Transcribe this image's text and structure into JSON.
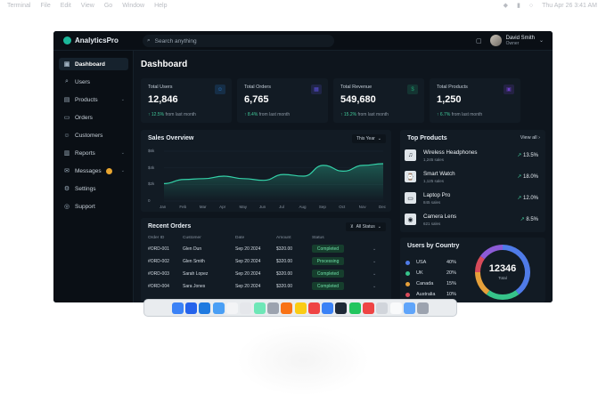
{
  "menubar": {
    "items": [
      "Terminal",
      "File",
      "Edit",
      "View",
      "Go",
      "Window",
      "Help"
    ],
    "clock": "Thu Apr 26 3:41 AM"
  },
  "app": {
    "brand": "AnalyticsPro",
    "search_placeholder": "Search anything",
    "user_name": "David Smith",
    "user_role": "Owner"
  },
  "sidebar": {
    "items": [
      {
        "label": "Dashboard",
        "icon": "dashboard-icon",
        "active": true
      },
      {
        "label": "Users",
        "icon": "search-icon"
      },
      {
        "label": "Products",
        "icon": "box-icon",
        "chevron": true
      },
      {
        "label": "Orders",
        "icon": "cart-icon"
      },
      {
        "label": "Customers",
        "icon": "users-icon"
      },
      {
        "label": "Reports",
        "icon": "chart-icon",
        "chevron": true
      },
      {
        "label": "Messages",
        "icon": "message-icon",
        "chevron": true
      },
      {
        "label": "Settings",
        "icon": "gear-icon"
      },
      {
        "label": "Support",
        "icon": "help-icon"
      }
    ]
  },
  "dashboard": {
    "title": "Dashboard",
    "stats": [
      {
        "label": "Total Users",
        "value": "12,846",
        "change": "↑ 12.5%",
        "note": "from last month",
        "color": "#2a7fd4"
      },
      {
        "label": "Total Orders",
        "value": "6,765",
        "change": "↑ 8.4%",
        "note": "from last month",
        "color": "#5a4fd6"
      },
      {
        "label": "Total Revenue",
        "value": "549,680",
        "change": "↑ 15.2%",
        "note": "from last month",
        "color": "#1f9a6e"
      },
      {
        "label": "Total Products",
        "value": "1,250",
        "change": "↑ 6.7%",
        "note": "from last month",
        "color": "#6c3fc4"
      }
    ]
  },
  "sales": {
    "title": "Sales Overview",
    "filter": "This Year"
  },
  "chart_data": {
    "type": "area",
    "title": "Sales Overview",
    "categories": [
      "Jan",
      "Feb",
      "Mar",
      "Apr",
      "May",
      "Jun",
      "Jul",
      "Aug",
      "Sep",
      "Oct",
      "Nov",
      "Dec"
    ],
    "values": [
      2.1,
      2.6,
      2.7,
      3.0,
      2.7,
      2.5,
      3.2,
      3.0,
      4.3,
      3.6,
      4.3,
      4.5
    ],
    "y_ticks": [
      "$6k",
      "$4k",
      "$2k",
      "0"
    ],
    "ylim": [
      0,
      6
    ]
  },
  "orders": {
    "title": "Recent Orders",
    "filter": "All Status",
    "columns": [
      "Order ID",
      "Customer",
      "Date",
      "Amount",
      "Status"
    ],
    "rows": [
      {
        "id": "#ORD-001",
        "customer": "Glen Dun",
        "date": "Sep 20 2024",
        "amount": "$320.00",
        "status": "Completed"
      },
      {
        "id": "#ORD-002",
        "customer": "Glen Smith",
        "date": "Sep 20 2024",
        "amount": "$320.00",
        "status": "Processing"
      },
      {
        "id": "#ORD-003",
        "customer": "Sarah Lopez",
        "date": "Sep 20 2024",
        "amount": "$320.00",
        "status": "Completed"
      },
      {
        "id": "#ORD-004",
        "customer": "Sara Jones",
        "date": "Sep 20 2024",
        "amount": "$320.00",
        "status": "Completed"
      }
    ]
  },
  "top_products": {
    "title": "Top Products",
    "view_all": "View all",
    "items": [
      {
        "name": "Wireless Headphones",
        "sub": "1,245 sales",
        "growth": "13.5%"
      },
      {
        "name": "Smart Watch",
        "sub": "1,125 sales",
        "growth": "18.0%"
      },
      {
        "name": "Laptop Pro",
        "sub": "845 sales",
        "growth": "12.0%"
      },
      {
        "name": "Camera Lens",
        "sub": "621 sales",
        "growth": "8.5%"
      }
    ]
  },
  "countries": {
    "title": "Users by Country",
    "total": "12346",
    "total_label": "Total",
    "items": [
      {
        "name": "USA",
        "pct": "40%",
        "color": "#4f7be8"
      },
      {
        "name": "UK",
        "pct": "20%",
        "color": "#36c38a"
      },
      {
        "name": "Canada",
        "pct": "15%",
        "color": "#e6a03a"
      },
      {
        "name": "Australia",
        "pct": "10%",
        "color": "#d84b5a"
      }
    ]
  },
  "dock": {
    "icon_colors": [
      "#3b82f6",
      "#2563eb",
      "#1f7ae0",
      "#4a9ff5",
      "#f3f4f6",
      "#e5e7eb",
      "#6ee7b7",
      "#9ca3af",
      "#f97316",
      "#facc15",
      "#ef4444",
      "#3b82f6",
      "#1f2937",
      "#22c55e",
      "#ef4444",
      "#d1d5db",
      "#f9fafb",
      "#60a5fa",
      "#9ca3af"
    ]
  }
}
